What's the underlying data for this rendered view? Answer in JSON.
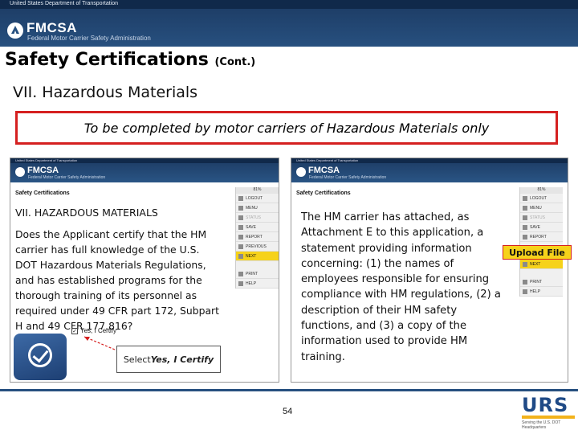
{
  "header": {
    "agency": "United States Department of Transportation",
    "brand": "FMCSA",
    "subtitle": "Federal Motor Carrier Safety Administration"
  },
  "slide": {
    "title": "Safety Certifications",
    "title_suffix": "(Cont.)",
    "section": "VII.  Hazardous Materials",
    "banner": "To be completed by motor carriers of Hazardous Materials only",
    "page_number": "54"
  },
  "left_screen": {
    "page_title": "Safety Certifications",
    "section": "VII. HAZARDOUS MATERIALS",
    "question": "Does the Applicant certify that the HM carrier has full knowledge of the U.S. DOT Hazardous Materials Regulations, and has established programs for the thorough training of its personnel as required under 49 CFR part 172, Subpart H and 49 CFR 177.816?",
    "checkbox_label": "Yes, I Certify",
    "callout_prefix": "Select ",
    "callout_bold": "Yes, I Certify"
  },
  "right_screen": {
    "page_title": "Safety Certifications",
    "text": "The HM carrier has attached, as Attachment E to this application, a statement providing information concerning: (1) the names of employees responsible for ensuring compliance with HM regulations, (2) a description of their HM safety functions, and (3) a copy of the information used to provide HM training.",
    "upload_label": "Upload File"
  },
  "side_menu": {
    "progress": "81%",
    "items": [
      "LOGOUT",
      "MENU",
      "STATUS",
      "SAVE",
      "REPORT",
      "PREVIOUS",
      "NEXT",
      "PRINT",
      "HELP"
    ]
  },
  "footer": {
    "logo": "URS",
    "tagline": "Serving the U.S. DOT Headquarters"
  },
  "colors": {
    "header_blue": "#27507f",
    "highlight_yellow": "#f6d21a",
    "banner_red": "#d52020"
  }
}
